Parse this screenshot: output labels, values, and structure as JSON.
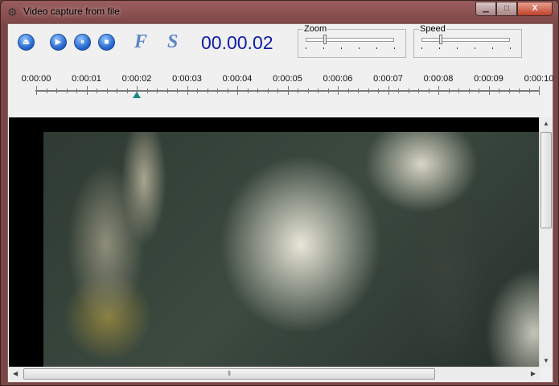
{
  "window": {
    "title": "Video capture from file",
    "minimize": "▁",
    "maximize": "□",
    "close": "X"
  },
  "toolbar": {
    "eject": "⏏",
    "play": "▶",
    "pause": "⏸",
    "stop": "■",
    "f_label": "F",
    "s_label": "S",
    "time": "00.00.02"
  },
  "zoom": {
    "label": "Zoom",
    "value": 0.2
  },
  "speed": {
    "label": "Speed",
    "value": 0.2
  },
  "timeline": {
    "labels": [
      "0:00:00",
      "0:00:01",
      "0:00:02",
      "0:00:03",
      "0:00:04",
      "0:00:05",
      "0:00:06",
      "0:00:07",
      "0:00:08",
      "0:00:09",
      "0:00:10"
    ],
    "position_seconds": 2
  },
  "scrollbar": {
    "grip": "⦀"
  }
}
